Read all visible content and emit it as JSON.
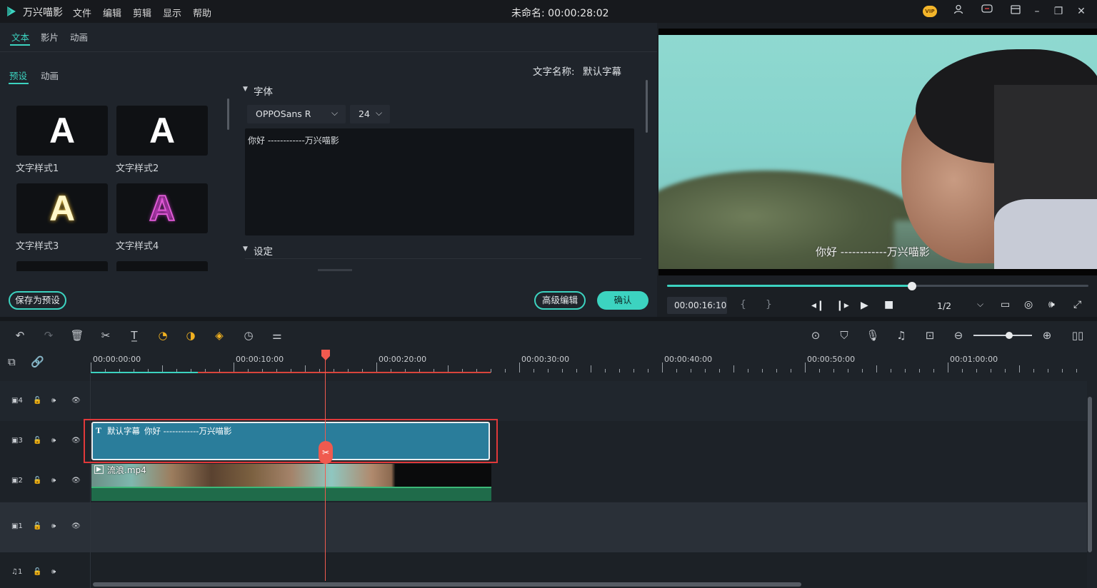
{
  "app": {
    "name": "万兴喵影",
    "project_title": "未命名: 00:00:28:02",
    "menu": [
      "文件",
      "编辑",
      "剪辑",
      "显示",
      "帮助"
    ],
    "vip_badge": "VIP"
  },
  "panel": {
    "top_tabs": [
      "文本",
      "影片",
      "动画"
    ],
    "sub_tabs": [
      "预设",
      "动画"
    ],
    "styles": [
      {
        "label": "文字样式1",
        "glyph": "A"
      },
      {
        "label": "文字样式2",
        "glyph": "A"
      },
      {
        "label": "文字样式3",
        "glyph": "A"
      },
      {
        "label": "文字样式4",
        "glyph": "A"
      }
    ],
    "text_name_label": "文字名称:",
    "text_name_value": "默认字幕",
    "font_section": "字体",
    "font_family": "OPPOSans R",
    "font_size": "24",
    "text_content": "你好 ------------万兴喵影",
    "settings_section": "设定",
    "save_preset": "保存为预设",
    "advanced_edit": "高级编辑",
    "confirm": "确认"
  },
  "preview": {
    "subtitle": "你好 ------------万兴喵影",
    "timecode": "00:00:16:10",
    "bracket_in": "{",
    "bracket_out": "}",
    "quality": "1/2",
    "progress": 0.49
  },
  "timeline": {
    "ruler": [
      "00:00:00:00",
      "00:00:10:00",
      "00:00:20:00",
      "00:00:30:00",
      "00:00:40:00",
      "00:00:50:00",
      "00:01:00:00"
    ],
    "tracks": [
      {
        "label": "4",
        "kind": "video"
      },
      {
        "label": "3",
        "kind": "video"
      },
      {
        "label": "2",
        "kind": "video"
      },
      {
        "label": "1",
        "kind": "video"
      },
      {
        "label": "1",
        "kind": "audio"
      }
    ],
    "title_clip": {
      "type_letter": "T",
      "name": "默认字幕",
      "text": "你好 ------------万兴喵影"
    },
    "video_clip": {
      "name": "流浪.mp4"
    }
  },
  "colors": {
    "accent": "#3cd3c0",
    "playhead": "#f05a4f",
    "selection": "#e0393a",
    "title_clip": "#2a7d9b",
    "video_clip": "#1f6b4a"
  }
}
